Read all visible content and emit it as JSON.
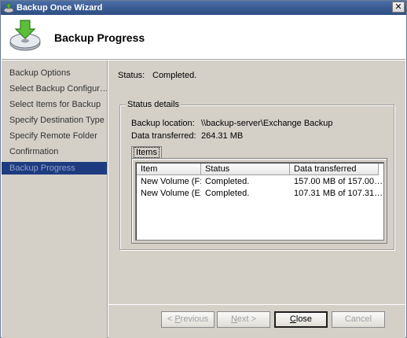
{
  "window": {
    "title": "Backup Once Wizard",
    "close_glyph": "✕"
  },
  "header": {
    "heading": "Backup Progress",
    "icon": "backup-disk-icon"
  },
  "sidebar": {
    "items": [
      {
        "label": "Backup Options",
        "selected": false
      },
      {
        "label": "Select Backup Configur…",
        "selected": false
      },
      {
        "label": "Select Items for Backup",
        "selected": false
      },
      {
        "label": "Specify Destination Type",
        "selected": false
      },
      {
        "label": "Specify Remote Folder",
        "selected": false
      },
      {
        "label": "Confirmation",
        "selected": false
      },
      {
        "label": "Backup Progress",
        "selected": true
      }
    ]
  },
  "status": {
    "label": "Status:",
    "value": "Completed."
  },
  "details": {
    "legend": "Status details",
    "location_label": "Backup location:",
    "location_value": "\\\\backup-server\\Exchange Backup",
    "transferred_label": "Data transferred:",
    "transferred_value": "264.31 MB",
    "tab_label": "Items",
    "columns": [
      "Item",
      "Status",
      "Data transferred"
    ],
    "rows": [
      [
        "New Volume (F:)",
        "Completed.",
        "157.00 MB of 157.00…"
      ],
      [
        "New Volume (E:)",
        "Completed.",
        "107.31 MB of 107.31…"
      ]
    ]
  },
  "buttons": {
    "previous": {
      "prefix": "< ",
      "accel": "P",
      "rest": "revious"
    },
    "next": {
      "accel": "N",
      "rest": "ext >"
    },
    "close": {
      "accel": "C",
      "rest": "lose"
    },
    "cancel": "Cancel"
  },
  "colors": {
    "selected_nav_bg": "#1f3b80",
    "panel_bg": "#d4d0c8",
    "title_bar": "#3b5c93"
  }
}
